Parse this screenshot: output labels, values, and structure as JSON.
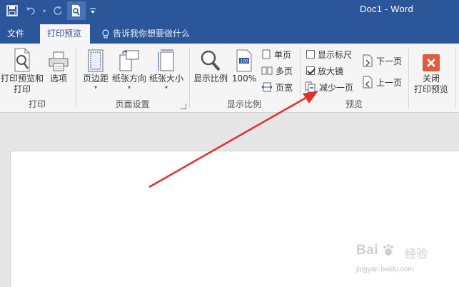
{
  "title_bar": {
    "document_title": "Doc1  -  Word",
    "quick_access": [
      "save-icon",
      "undo-icon",
      "redo-icon",
      "print-preview-icon",
      "customize-qat-icon"
    ]
  },
  "tabs": {
    "file": "文件",
    "print_preview": "打印预览",
    "tell_me": "告诉我你想要做什么"
  },
  "ribbon": {
    "print_group": {
      "label": "打印",
      "print_preview_and_print": [
        "打印预览和",
        "打印"
      ],
      "options": "选项"
    },
    "page_setup_group": {
      "label": "页面设置",
      "margins": "页边距",
      "orientation": "纸张方向",
      "size": "纸张大小"
    },
    "zoom_group": {
      "label": "显示比例",
      "zoom": "显示比例",
      "hundred": "100%",
      "one_page": "单页",
      "multiple_pages": "多页",
      "page_width": "页宽"
    },
    "preview_group": {
      "label": "预览",
      "show_ruler": "显示标尺",
      "show_ruler_checked": false,
      "magnifier": "放大镜",
      "magnifier_checked": true,
      "shrink_one_page": "减少一页",
      "next_page": "下一页",
      "previous_page": "上一页"
    },
    "close_group": {
      "close_print_preview": [
        "关闭",
        "打印预览"
      ]
    }
  },
  "watermark": {
    "brand": "Bai",
    "brand_cn": "经验",
    "url": "jingyan.baidu.com"
  },
  "colors": {
    "title_blue": "#2b579a",
    "arrow_red": "#e03030",
    "close_red": "#e05a3f"
  }
}
